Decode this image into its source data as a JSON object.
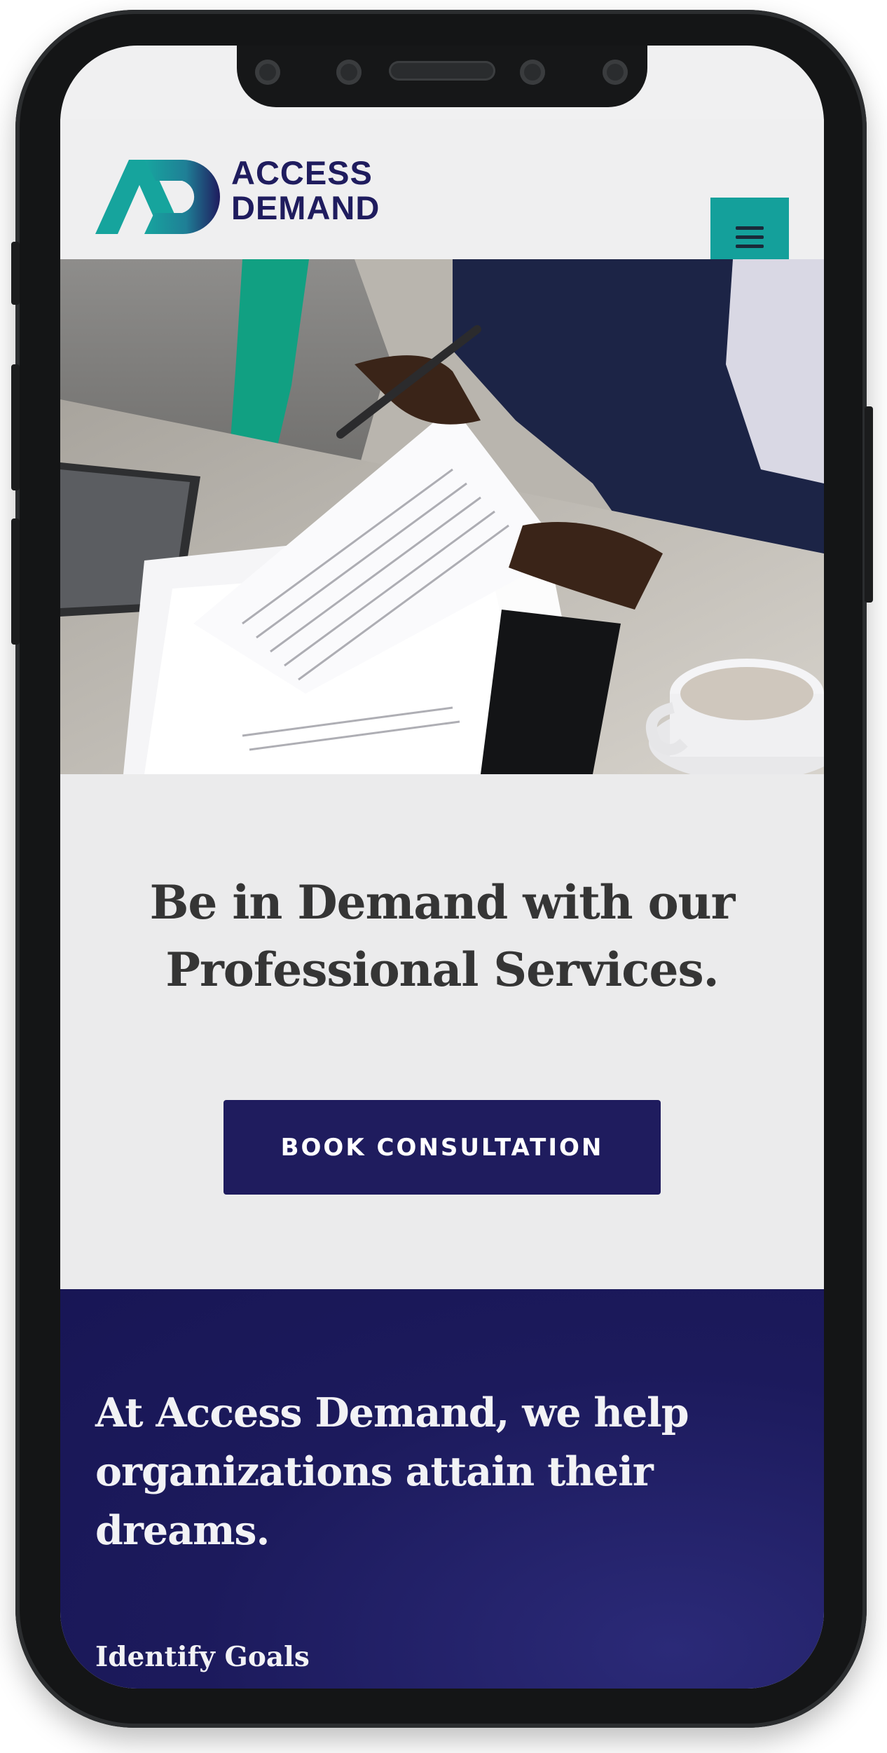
{
  "header": {
    "logo_line1": "ACCESS",
    "logo_line2": "DEMAND",
    "menu_icon": "hamburger-menu-icon"
  },
  "hero": {
    "title_line1": "Be in Demand with our",
    "title_line2": "Professional Services.",
    "cta_label": "BOOK CONSULTATION"
  },
  "about": {
    "title": "At Access Demand, we help organizations attain their dreams.",
    "subheading": "Identify Goals"
  },
  "colors": {
    "brand_navy": "#1f1c5e",
    "brand_teal": "#14a09b",
    "page_background": "#efeff0"
  }
}
